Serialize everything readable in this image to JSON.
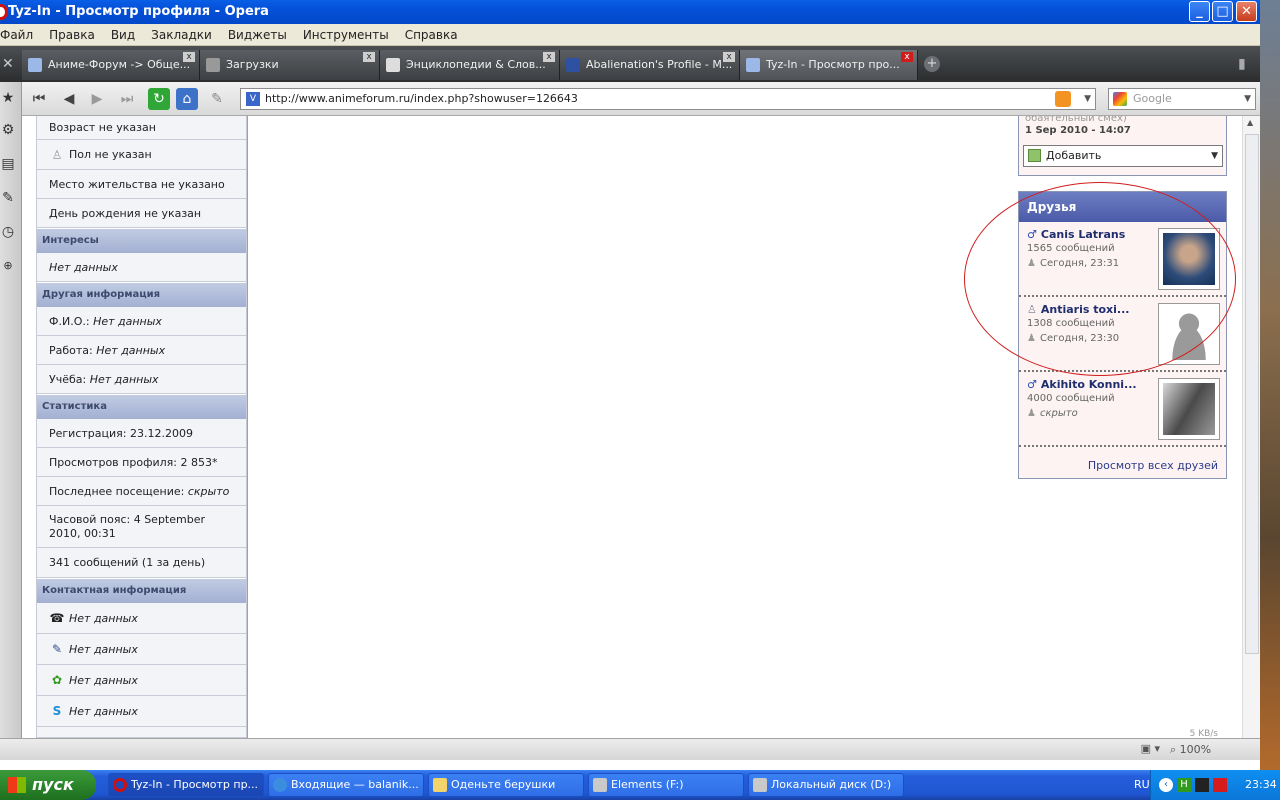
{
  "window": {
    "title": "Tyz-In - Просмотр профиля - Opera"
  },
  "menu": [
    "Файл",
    "Правка",
    "Вид",
    "Закладки",
    "Виджеты",
    "Инструменты",
    "Справка"
  ],
  "tabs": [
    {
      "label": "Аниме-Форум -> Обще..."
    },
    {
      "label": "Загрузки"
    },
    {
      "label": "Энциклопедии & Слов..."
    },
    {
      "label": "Abalienation's Profile - M..."
    },
    {
      "label": "Tyz-In - Просмотр про..."
    }
  ],
  "address": {
    "url": "http://www.animeforum.ru/index.php?showuser=126643",
    "search_placeholder": "Google"
  },
  "profile": {
    "age": "Возраст не указан",
    "gender": "Пол не указан",
    "location": "Место жительства не указано",
    "birthday": "День рождения не указан",
    "interests_header": "Интересы",
    "interests_value": "Нет данных",
    "other_header": "Другая информация",
    "fio_label": "Ф.И.О.:",
    "fio_value": "Нет данных",
    "work_label": "Работа:",
    "work_value": "Нет данных",
    "study_label": "Учёба:",
    "study_value": "Нет данных",
    "stats_header": "Статистика",
    "registration": "Регистрация: 23.12.2009",
    "views": "Просмотров профиля: 2 853*",
    "last_visit_label": "Последнее посещение:",
    "last_visit_value": "скрыто",
    "timezone": "Часовой пояс: 4 September 2010, 00:31",
    "posts": "341 сообщений (1 за день)",
    "contact_header": "Контактная информация",
    "contact_phone": "Нет данных",
    "contact_email": "Нет данных",
    "contact_icq": "Нет данных",
    "contact_skype": "Нет данных"
  },
  "comments": {
    "snippet": "обаятельный смех)",
    "date": "1 Sep 2010 - 14:07",
    "add_label": "Добавить"
  },
  "friends": {
    "header": "Друзья",
    "items": [
      {
        "name": "Canis Latrans",
        "posts": "1565 сообщений",
        "seen": "Сегодня, 23:31"
      },
      {
        "name": "Antiaris toxi...",
        "posts": "1308 сообщений",
        "seen": "Сегодня, 23:30"
      },
      {
        "name": "Akihito Konni...",
        "posts": "4000 сообщений",
        "seen": "скрыто"
      }
    ],
    "view_all": "Просмотр всех друзей"
  },
  "status": {
    "zoom": "100%",
    "speed": "5 KB/s"
  },
  "taskbar": {
    "start": "пуск",
    "items": [
      {
        "label": "Tyz-In - Просмотр пр..."
      },
      {
        "label": "Входящие — balanik..."
      },
      {
        "label": "Оденьте берушки"
      },
      {
        "label": "Elements (F:)"
      },
      {
        "label": "Локальный диск (D:)"
      }
    ],
    "lang": "RU",
    "clock": "23:34"
  }
}
